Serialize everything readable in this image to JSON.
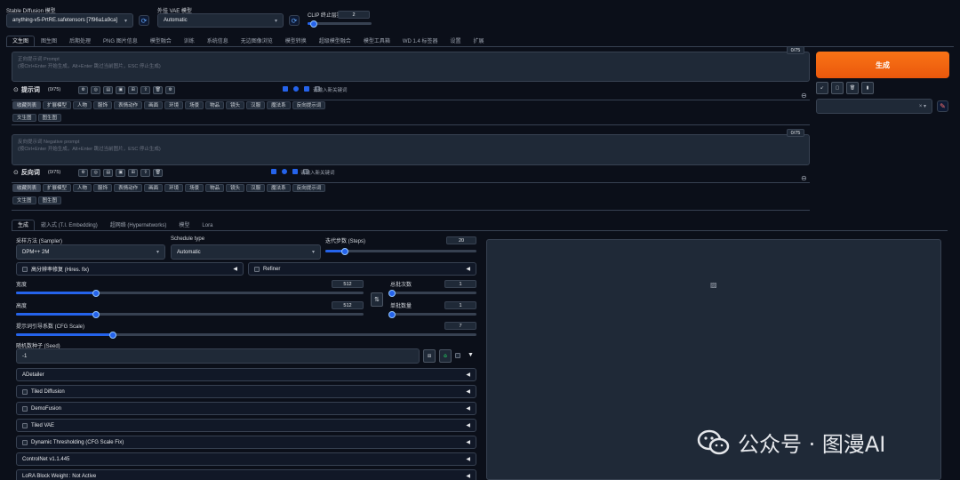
{
  "model": {
    "label": "Stable Diffusion 模型",
    "value": "anything-v5-PrtRE.safetensors [7f96a1a9ca]"
  },
  "vae": {
    "label": "外挂 VAE 模型",
    "value": "Automatic"
  },
  "clip": {
    "label": "CLIP 终止层数",
    "value": "2"
  },
  "main_tabs": [
    "文生图",
    "图生图",
    "后期处理",
    "PNG 图片信息",
    "模型融合",
    "训练",
    "系统信息",
    "无边图像浏览",
    "模型转换",
    "超级模型融合",
    "模型工具箱",
    "WD 1.4 标签器",
    "设置",
    "扩展"
  ],
  "prompt": {
    "placeholder_line1": "正向提示词 Prompt",
    "placeholder_line2": "(按Ctrl+Enter 开始生成，Alt+Enter 跳过当前图片，ESC 停止生成)",
    "counter": "0/75",
    "bar_label": "提示词",
    "bar_count": "(0/75)",
    "keyword_placeholder": "请输入新关键词"
  },
  "neg": {
    "placeholder_line1": "反向提示词 Negative prompt",
    "placeholder_line2": "(按Ctrl+Enter 开始生成，Alt+Enter 跳过当前图片，ESC 停止生成)",
    "counter": "0/75",
    "bar_label": "反向词",
    "bar_count": "(0/75)",
    "keyword_placeholder": "请输入新关键词"
  },
  "chips": [
    "收藏列表",
    "扩展模型",
    "人物",
    "服饰",
    "表情动作",
    "画面",
    "环境",
    "场景",
    "物品",
    "镜头",
    "汉服",
    "魔法系",
    "反向提示词"
  ],
  "subchips": [
    "文生图",
    "图生图"
  ],
  "generate": "生成",
  "sub_tabs": [
    "生成",
    "嵌入式 (T.I. Embedding)",
    "超网络 (Hypernetworks)",
    "模型",
    "Lora"
  ],
  "sampler": {
    "label": "采样方法 (Sampler)",
    "value": "DPM++ 2M"
  },
  "schedule": {
    "label": "Schedule type",
    "value": "Automatic"
  },
  "steps": {
    "label": "迭代步数 (Steps)",
    "value": "20",
    "fraction": 0.13
  },
  "hires": "高分辨率修复 (Hires. fix)",
  "refiner": "Refiner",
  "width": {
    "label": "宽度",
    "value": "512",
    "fraction": 0.23
  },
  "height": {
    "label": "高度",
    "value": "512",
    "fraction": 0.23
  },
  "batch_count": {
    "label": "总批次数",
    "value": "1",
    "fraction": 0.0
  },
  "batch_size": {
    "label": "单批数量",
    "value": "1",
    "fraction": 0.0
  },
  "cfg": {
    "label": "提示词引导系数 (CFG Scale)",
    "value": "7",
    "fraction": 0.21
  },
  "seed": {
    "label": "随机数种子 (Seed)",
    "value": "-1"
  },
  "accordions": [
    {
      "label": "ADetailer",
      "checkbox": false
    },
    {
      "label": "Tiled Diffusion",
      "checkbox": true
    },
    {
      "label": "DemoFusion",
      "checkbox": true
    },
    {
      "label": "Tiled VAE",
      "checkbox": true
    },
    {
      "label": "Dynamic Thresholding (CFG Scale Fix)",
      "checkbox": true
    },
    {
      "label": "ControlNet v1.1.445",
      "checkbox": false
    },
    {
      "label": "LoRA Block Weight : Not Active",
      "checkbox": false
    }
  ],
  "watermark": "公众号 · 图漫AI",
  "colors": {
    "accent": "#2563eb",
    "generate": "#f97316",
    "bg": "#0b0f19"
  }
}
